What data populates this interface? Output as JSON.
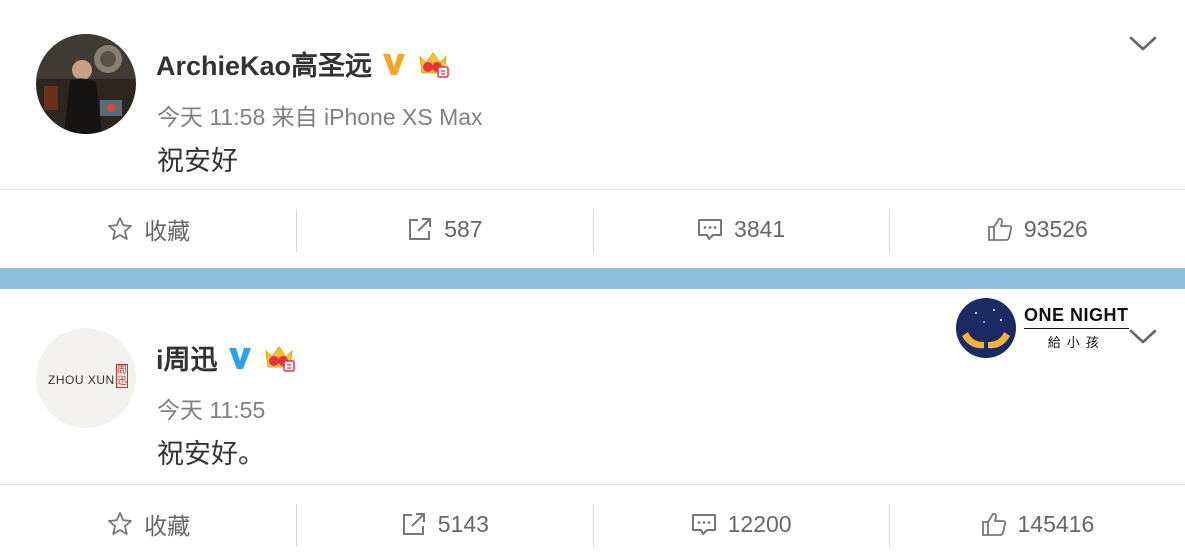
{
  "posts": [
    {
      "username": "ArchieKao高圣远",
      "meta": "今天 11:58 来自 iPhone XS Max",
      "content": "祝安好",
      "verified_color": "#f5a623",
      "actions": {
        "favorite": "收藏",
        "repost": "587",
        "comment": "3841",
        "like": "93526"
      }
    },
    {
      "username": "i周迅",
      "meta": "今天 11:55",
      "content": "祝安好。",
      "verified_color": "#2aa3ef",
      "avatar_text": "ZHOU XUN",
      "avatar_seal": "周迅",
      "actions": {
        "favorite": "收藏",
        "repost": "5143",
        "comment": "12200",
        "like": "145416"
      }
    }
  ],
  "ad": {
    "title": "ONE NIGHT",
    "subtitle": "給小孩"
  },
  "icons": {
    "verified": "verified-v-icon",
    "crown": "crown-member-icon",
    "chevron": "chevron-down-icon",
    "favorite": "star-icon",
    "repost": "repost-icon",
    "comment": "comment-icon",
    "like": "thumbs-up-icon"
  },
  "colors": {
    "divider_band": "#8ebfdc",
    "text_primary": "#333333",
    "text_meta": "#808080"
  }
}
